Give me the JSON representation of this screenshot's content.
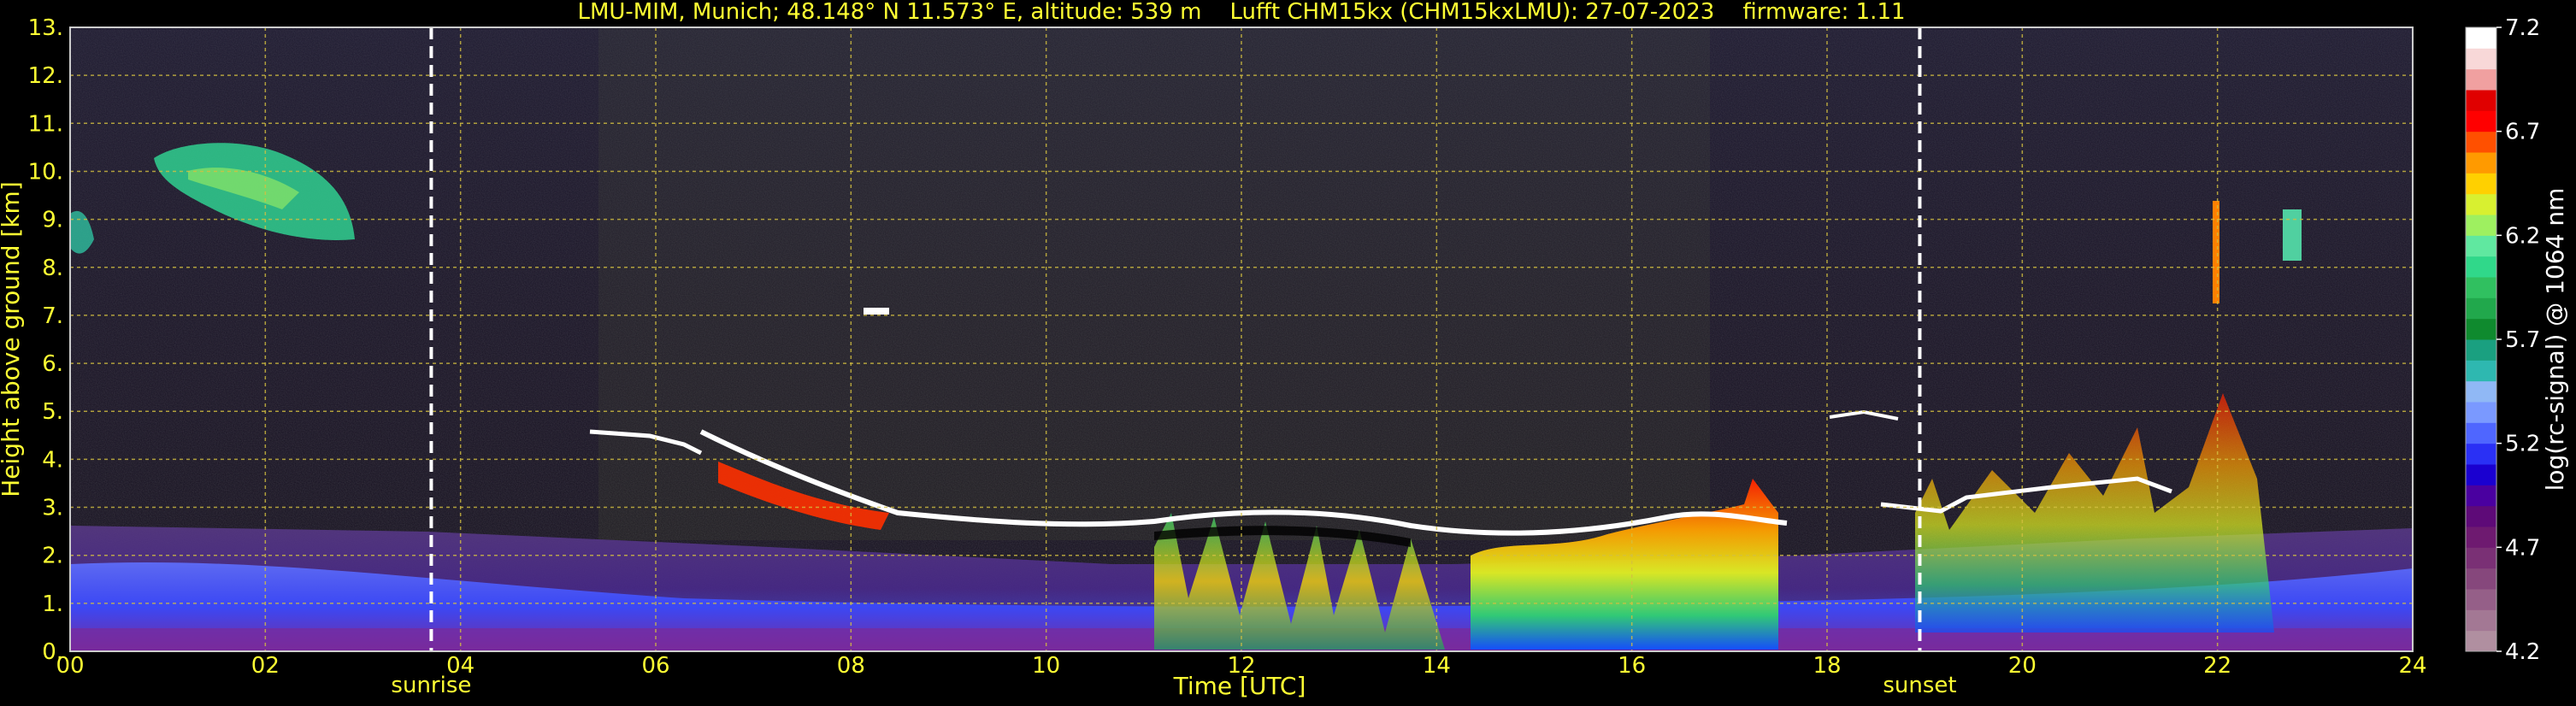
{
  "chart_data": {
    "type": "heatmap",
    "title": "LMU-MIM, Munich; 48.148° N 11.573° E, altitude: 539 m    Lufft CHM15kx (CHM15kxLMU): 27-07-2023    firmware: 1.11",
    "xlabel": "Time [UTC]",
    "ylabel": "Height above ground [km]",
    "xlim": [
      0,
      24
    ],
    "ylim": [
      0,
      13
    ],
    "x_ticks": [
      "00",
      "02",
      "04",
      "06",
      "08",
      "10",
      "12",
      "14",
      "16",
      "18",
      "20",
      "22",
      "24"
    ],
    "y_ticks": [
      "0.",
      "1.",
      "2.",
      "3.",
      "4.",
      "5.",
      "6.",
      "7.",
      "8.",
      "9.",
      "10.",
      "11.",
      "12.",
      "13."
    ],
    "grid": true,
    "markers": [
      {
        "label": "sunrise",
        "time": 3.7
      },
      {
        "label": "sunset",
        "time": 18.95
      }
    ],
    "colorbar": {
      "label": "log(rc-signal) @ 1064 nm",
      "range": [
        4.2,
        7.2
      ],
      "ticks": [
        "4.2",
        "4.7",
        "5.2",
        "5.7",
        "6.2",
        "6.7",
        "7.2"
      ],
      "colors": [
        "#b08fa0",
        "#a37894",
        "#955f88",
        "#86477c",
        "#7a3075",
        "#6e1a70",
        "#5e0a78",
        "#4a00a0",
        "#1a00d0",
        "#2a30f5",
        "#4f66ff",
        "#7a99ff",
        "#90b8f5",
        "#2eb8b0",
        "#1aa080",
        "#0f8a2e",
        "#21a84c",
        "#30c060",
        "#30d88a",
        "#60e8a0",
        "#9ef060",
        "#d8f030",
        "#ffd000",
        "#ff9a00",
        "#ff5000",
        "#ff0000",
        "#e00000",
        "#f0a0a0",
        "#f8d8d8",
        "#ffffff"
      ]
    }
  }
}
